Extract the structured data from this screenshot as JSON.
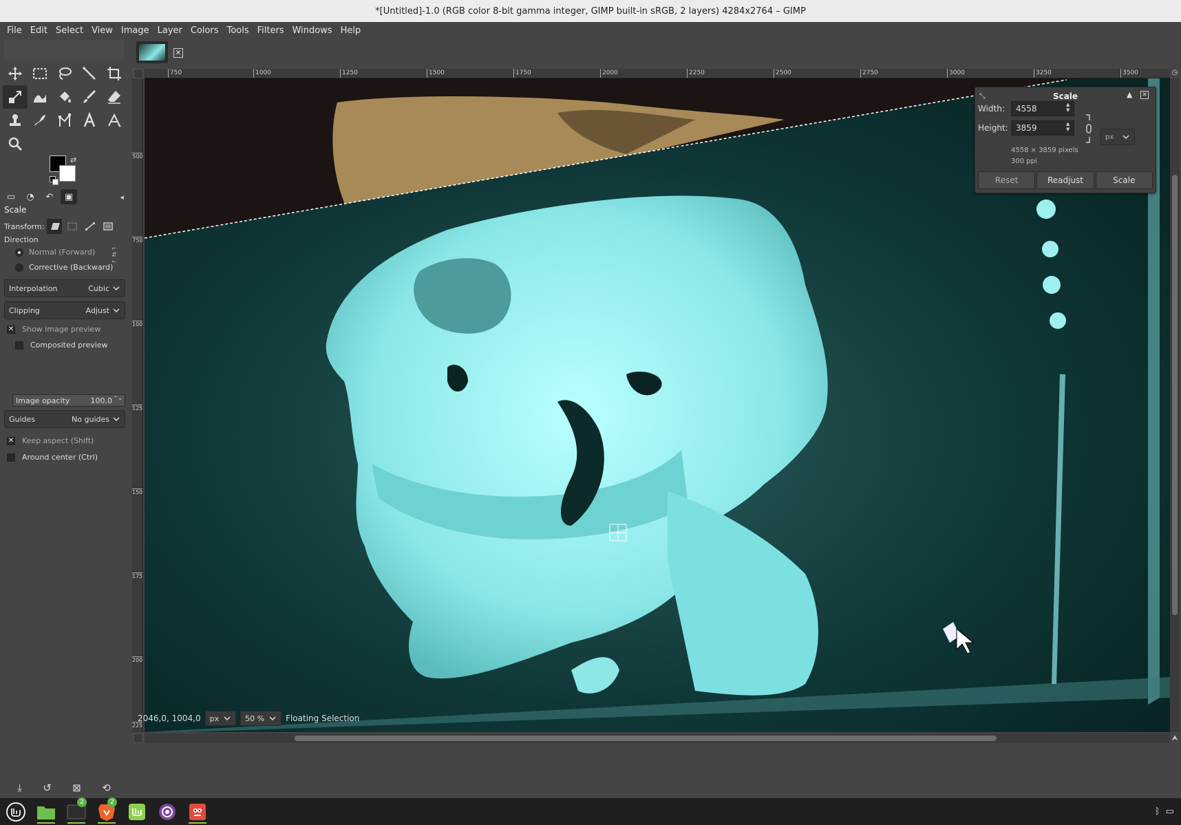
{
  "window": {
    "title": "*[Untitled]-1.0 (RGB color 8-bit gamma integer, GIMP built-in sRGB, 2 layers) 4284x2764 – GIMP"
  },
  "menubar": [
    "File",
    "Edit",
    "Select",
    "View",
    "Image",
    "Layer",
    "Colors",
    "Tools",
    "Filters",
    "Windows",
    "Help"
  ],
  "toolbox": {
    "tools": [
      "move-icon",
      "rect-select-icon",
      "lasso-icon",
      "fuzzy-select-icon",
      "crop-icon",
      "scale-icon",
      "warp-icon",
      "bucket-fill-icon",
      "paintbrush-icon",
      "eraser-icon",
      "clone-icon",
      "smudge-icon",
      "paths-icon",
      "text-icon",
      "measure-icon",
      "zoom-icon"
    ],
    "active_tool_index": 5,
    "fg_color": "#000000",
    "bg_color": "#ffffff"
  },
  "tool_options": {
    "title": "Scale",
    "transform_label": "Transform:",
    "direction_label": "Direction",
    "direction_normal": "Normal (Forward)",
    "direction_corrective": "Corrective (Backward)",
    "interpolation_label": "Interpolation",
    "interpolation_value": "Cubic",
    "clipping_label": "Clipping",
    "clipping_value": "Adjust",
    "show_preview": "Show image preview",
    "composited_preview": "Composited preview",
    "image_opacity_label": "Image opacity",
    "image_opacity_value": "100,0",
    "guides_label": "Guides",
    "guides_value": "No guides",
    "keep_aspect": "Keep aspect (Shift)",
    "around_center": "Around center (Ctrl)"
  },
  "rulers": {
    "h_labels": [
      "750",
      "1000",
      "1250",
      "1500",
      "1750",
      "2000",
      "2250",
      "2500",
      "2750",
      "3000",
      "3250",
      "3500"
    ],
    "v_labels": [
      "500",
      "750",
      "1000",
      "1250",
      "1500",
      "1750",
      "2000",
      "2250"
    ]
  },
  "scale_dialog": {
    "title": "Scale",
    "width_label": "Width:",
    "width_value": "4558",
    "height_label": "Height:",
    "height_value": "3859",
    "unit": "px",
    "size_info": "4558 × 3859 pixels",
    "resolution_info": "300 ppi",
    "reset": "Reset",
    "readjust": "Readjust",
    "scale": "Scale"
  },
  "statusbar": {
    "coords": "2046,0, 1004,0",
    "unit": "px",
    "zoom": "50 %",
    "message": "Floating Selection"
  },
  "taskbar": {
    "apps": [
      "mint-menu-icon",
      "files-icon",
      "terminal-icon",
      "brave-icon",
      "mint-update-icon",
      "tor-icon",
      "gimp-icon"
    ],
    "badge_terminal": "2",
    "badge_brave": "2"
  },
  "colors": {
    "teal_bg": "#0f3636",
    "skull": "#9ff3f3",
    "accent": "#8fce4f"
  }
}
